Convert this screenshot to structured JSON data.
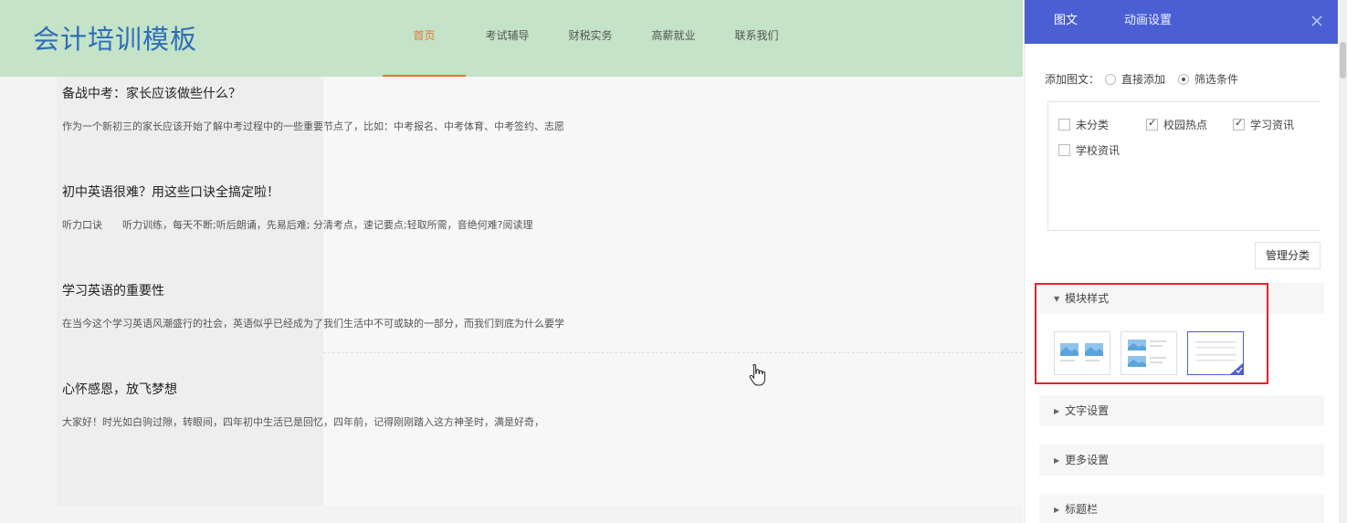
{
  "site": {
    "logo": "会计培训模板",
    "nav": [
      {
        "label": "首页",
        "active": true
      },
      {
        "label": "考试辅导",
        "active": false
      },
      {
        "label": "财税实务",
        "active": false
      },
      {
        "label": "高薪就业",
        "active": false
      },
      {
        "label": "联系我们",
        "active": false
      }
    ]
  },
  "articles": [
    {
      "title": "备战中考：家长应该做些什么？",
      "summary": "作为一个新初三的家长应该开始了解中考过程中的一些重要节点了，比如：中考报名、中考体育、中考签约、志愿"
    },
    {
      "title": "初中英语很难？用这些口诀全搞定啦！",
      "summary": "听力口诀　　听力训练，每天不断;听后朗诵，先易后难; 分清考点，速记要点;轻取所需，音绝何难?阅读理"
    },
    {
      "title": "学习英语的重要性",
      "summary": "在当今这个学习英语风潮盛行的社会，英语似乎已经成为了我们生活中不可或缺的一部分，而我们到底为什么要学"
    },
    {
      "title": "心怀感恩，放飞梦想",
      "summary": "大家好！时光如白驹过隙，转眼间，四年初中生活已是回忆，四年前，记得刚刚踏入这方神圣时，满是好奇，"
    }
  ],
  "panel": {
    "tabs": [
      "图文",
      "动画设置"
    ],
    "add_label": "添加图文：",
    "add_options": [
      {
        "label": "直接添加",
        "checked": false
      },
      {
        "label": "筛选条件",
        "checked": true
      }
    ],
    "categories": [
      {
        "label": "未分类",
        "checked": false
      },
      {
        "label": "校园热点",
        "checked": true
      },
      {
        "label": "学习资讯",
        "checked": true
      },
      {
        "label": "学校资讯",
        "checked": false
      }
    ],
    "manage_button": "管理分类",
    "sections": [
      "模块样式",
      "文字设置",
      "更多设置",
      "标题栏"
    ],
    "accent_color": "#4b5fd4",
    "highlight_color": "#e8212a"
  }
}
